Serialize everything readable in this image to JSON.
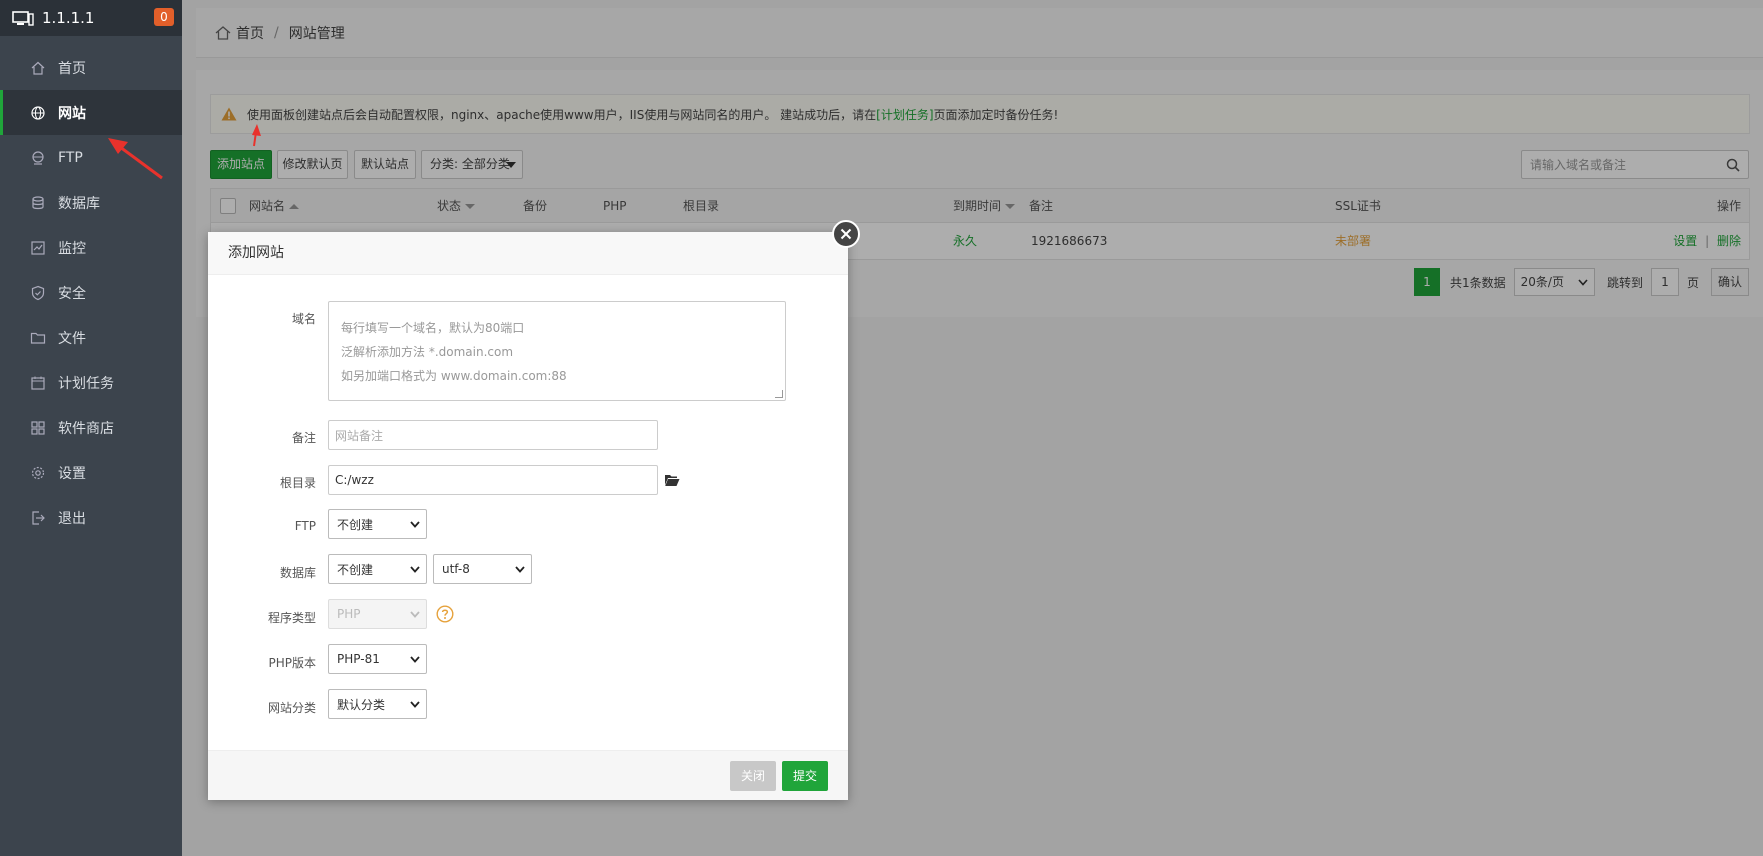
{
  "sidebar": {
    "host": "1.1.1.1",
    "badge": "0",
    "items": [
      {
        "label": "首页",
        "icon": "home-icon"
      },
      {
        "label": "网站",
        "icon": "globe-icon",
        "active": true
      },
      {
        "label": "FTP",
        "icon": "ftp-icon"
      },
      {
        "label": "数据库",
        "icon": "database-icon"
      },
      {
        "label": "监控",
        "icon": "monitor-icon"
      },
      {
        "label": "安全",
        "icon": "shield-icon"
      },
      {
        "label": "文件",
        "icon": "folder-icon"
      },
      {
        "label": "计划任务",
        "icon": "calendar-icon"
      },
      {
        "label": "软件商店",
        "icon": "grid-icon"
      },
      {
        "label": "设置",
        "icon": "gear-icon"
      },
      {
        "label": "退出",
        "icon": "logout-icon"
      }
    ]
  },
  "breadcrumb": {
    "home": "首页",
    "sep": "/",
    "current": "网站管理"
  },
  "notice": {
    "text_before": "使用面板创建站点后会自动配置权限，nginx、apache使用www用户，IIS使用与网站同名的用户。 建站成功后，请在",
    "link": "[计划任务]",
    "text_after": "页面添加定时备份任务!"
  },
  "toolbar": {
    "add_site": "添加站点",
    "edit_default_page": "修改默认页",
    "default_site": "默认站点",
    "category": "分类: 全部分类",
    "search_placeholder": "请输入域名或备注"
  },
  "table": {
    "headers": {
      "name": "网站名",
      "status": "状态",
      "backup": "备份",
      "php": "PHP",
      "root": "根目录",
      "expire": "到期时间",
      "note": "备注",
      "ssl": "SSL证书",
      "ops": "操作"
    },
    "row": {
      "expire": "永久",
      "note": "1921686673",
      "ssl": "未部署",
      "op_settings": "设置",
      "op_sep": "|",
      "op_delete": "删除"
    }
  },
  "pager": {
    "current": "1",
    "total": "共1条数据",
    "per_page": "20条/页",
    "goto": "跳转到",
    "page_input": "1",
    "page_unit": "页",
    "confirm": "确认"
  },
  "modal": {
    "title": "添加网站",
    "domain_label": "域名",
    "domain_placeholder": [
      "每行填写一个域名，默认为80端口",
      "泛解析添加方法 *.domain.com",
      "如另加端口格式为 www.domain.com:88"
    ],
    "note_label": "备注",
    "note_placeholder": "网站备注",
    "root_label": "根目录",
    "root_value": "C:/wzz",
    "ftp_label": "FTP",
    "ftp_value": "不创建",
    "db_label": "数据库",
    "db_value": "不创建",
    "db_charset": "utf-8",
    "program_label": "程序类型",
    "program_value": "PHP",
    "php_version_label": "PHP版本",
    "php_version_value": "PHP-81",
    "category_label": "网站分类",
    "category_value": "默认分类",
    "close_button": "关闭",
    "submit_button": "提交"
  },
  "colors": {
    "accent": "#20a53a",
    "sidebar": "#3c444d",
    "badge": "#e25f2a",
    "warning": "#e6a23c",
    "annotation": "#e8322c"
  }
}
